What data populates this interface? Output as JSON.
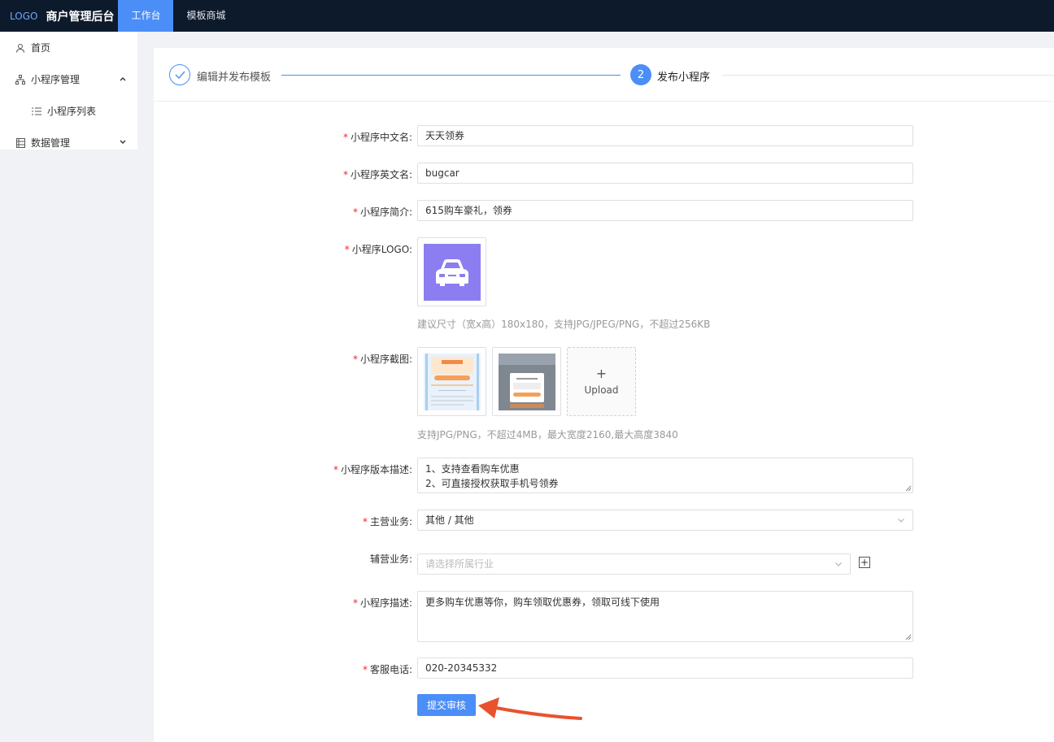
{
  "topbar": {
    "logo": "LOGO",
    "title": "商户管理后台",
    "tabs": [
      {
        "label": "工作台",
        "active": true
      },
      {
        "label": "模板商城",
        "active": false
      }
    ]
  },
  "sidebar": {
    "items": [
      {
        "label": "首页",
        "icon": "user-icon"
      },
      {
        "label": "小程序管理",
        "icon": "sitemap-icon",
        "expanded": true
      },
      {
        "label": "小程序列表",
        "icon": "list-icon"
      },
      {
        "label": "数据管理",
        "icon": "database-icon",
        "expanded": false
      }
    ]
  },
  "steps": [
    {
      "label": "编辑并发布模板",
      "status": "done"
    },
    {
      "label": "发布小程序",
      "number": "2",
      "status": "active"
    }
  ],
  "form": {
    "cn_name": {
      "label": "小程序中文名:",
      "value": "天天领券"
    },
    "en_name": {
      "label": "小程序英文名:",
      "value": "bugcar"
    },
    "intro": {
      "label": "小程序简介:",
      "value": "615购车豪礼，领券"
    },
    "logo": {
      "label": "小程序LOGO:",
      "hint": "建议尺寸（宽x高）180x180，支持JPG/JPEG/PNG，不超过256KB",
      "bg_color": "#8c7ef0"
    },
    "screenshots": {
      "label": "小程序截图:",
      "upload_label": "Upload",
      "hint": "支持JPG/PNG，不超过4MB，最大宽度2160,最大高度3840"
    },
    "version_desc": {
      "label": "小程序版本描述:",
      "lines": [
        "1、支持查看购车优惠",
        "2、可直接授权获取手机号领券"
      ]
    },
    "main_business": {
      "label": "主营业务:",
      "value": "其他 / 其他"
    },
    "sub_business": {
      "label": "辅营业务:",
      "placeholder": "请选择所属行业"
    },
    "description": {
      "label": "小程序描述:",
      "value": "更多购车优惠等你，购车领取优惠券，领取可线下使用"
    },
    "phone": {
      "label": "客服电话:",
      "value": "020-20345332"
    },
    "required_mark": "*",
    "submit_label": "提交审核"
  },
  "colors": {
    "primary": "#4c8ef7",
    "topbar": "#0d1a2c",
    "annotation_arrow": "#e8522e"
  }
}
